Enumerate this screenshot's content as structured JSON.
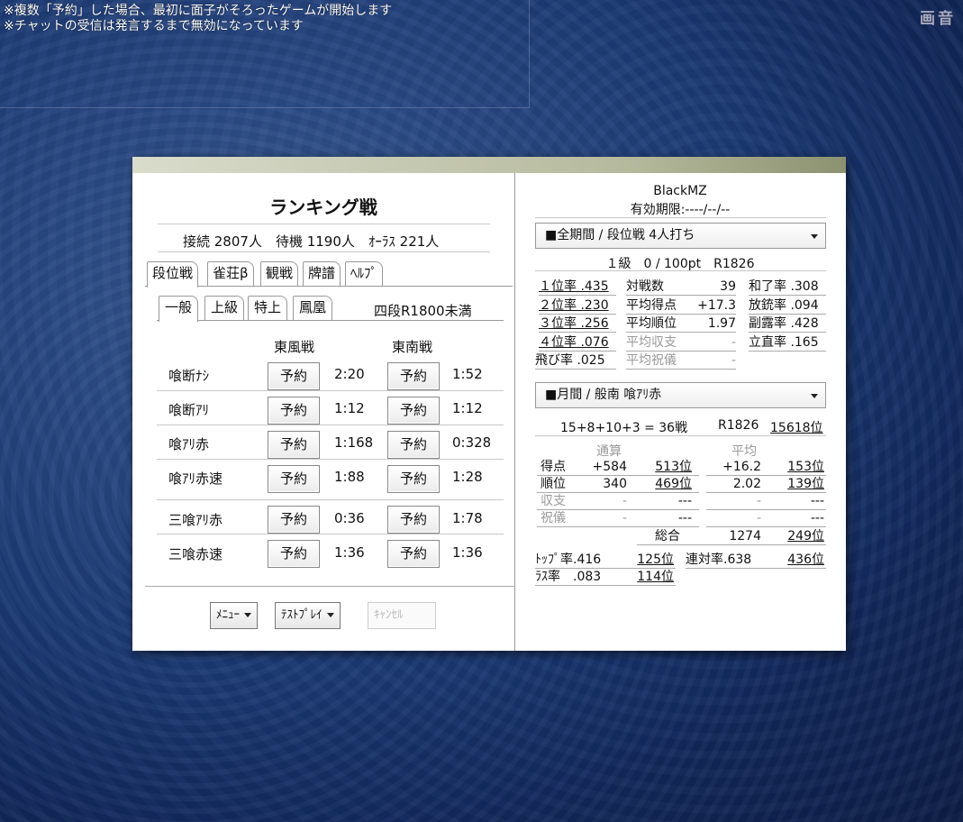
{
  "notice": {
    "line1": "※複数「予約」した場合、最初に面子がそろったゲームが開始します",
    "line2": "※チャットの受信は発言するまで無効になっています",
    "corner": "画音"
  },
  "left": {
    "title": "ランキング戦",
    "connections": "接続 2807人　待機 1190人　ｵｰﾗｽ 221人",
    "tabs": [
      "段位戦",
      "雀荘β",
      "観戦",
      "牌譜",
      "ﾍﾙﾌﾟ"
    ],
    "subtabs": [
      "一般",
      "上級",
      "特上",
      "鳳凰"
    ],
    "rank_limit": "四段R1800未満",
    "col_east": "東風戦",
    "col_south": "東南戦",
    "reserve": "予約",
    "rows": [
      {
        "label": "喰断ﾅｼ",
        "east": "2:20",
        "south": "1:52"
      },
      {
        "label": "喰断ｱﾘ",
        "east": "1:12",
        "south": "1:12"
      },
      {
        "label": "喰ｱﾘ赤",
        "east": "1:168",
        "south": "0:328"
      },
      {
        "label": "喰ｱﾘ赤速",
        "east": "1:88",
        "south": "1:28"
      },
      {
        "label": "三喰ｱﾘ赤",
        "east": "0:36",
        "south": "1:78"
      },
      {
        "label": "三喰赤速",
        "east": "1:36",
        "south": "1:36"
      }
    ],
    "menu": "ﾒﾆｭｰ",
    "testplay": "ﾃｽﾄﾌﾟﾚｲ",
    "cancel": "ｷｬﾝｾﾙ"
  },
  "right": {
    "player": "BlackMZ",
    "expiry": "有効期限:----/--/--",
    "dropdown1": "■全期間 / 段位戦 4人打ち",
    "rank": "１級　0 / 100pt　R1826",
    "stats": {
      "r1": "１位率 .435",
      "r2": "２位率 .230",
      "r3": "３位率 .256",
      "r4": "４位率 .076",
      "tobi": "飛び率 .025",
      "games_l": "対戦数",
      "games_v": "39",
      "avgpt_l": "平均得点",
      "avgpt_v": "+17.3",
      "avgrank_l": "平均順位",
      "avgrank_v": "1.97",
      "avgbal_l": "平均収支",
      "avgbal_v": "-",
      "avgbonus_l": "平均祝儀",
      "avgbonus_v": "-",
      "win": "和了率 .308",
      "deal": "放銃率 .094",
      "meld": "副露率 .428",
      "riichi": "立直率 .165"
    },
    "dropdown2": "■月間 / 般南 喰ｱﾘ赤",
    "month_games": "15+8+10+3 = 36戦",
    "month_r": "R1826",
    "month_pos": "15618位",
    "h_total": "通算",
    "h_avg": "平均",
    "mrows": [
      {
        "l": "得点",
        "a": "+584",
        "b": "513位",
        "c": "+16.2",
        "d": "153位"
      },
      {
        "l": "順位",
        "a": "340",
        "b": "469位",
        "c": "2.02",
        "d": "139位"
      },
      {
        "l": "収支",
        "a": "-",
        "b": "---",
        "c": "-",
        "d": "---"
      },
      {
        "l": "祝儀",
        "a": "-",
        "b": "---",
        "c": "-",
        "d": "---"
      }
    ],
    "overall_l": "総合",
    "overall_v": "1274",
    "overall_pos": "249位",
    "top_l": "ﾄｯﾌﾟ率.416",
    "top_pos": "125位",
    "ren_l": "連対率.638",
    "ren_pos": "436位",
    "las_l": "ﾗｽ率　.083",
    "las_pos": "114位"
  }
}
